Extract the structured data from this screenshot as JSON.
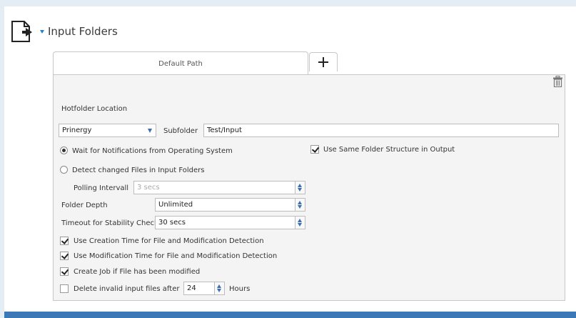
{
  "section": {
    "title": "Input Folders",
    "icon": "folder-output-icon"
  },
  "tabs": [
    {
      "label": "Default Path",
      "active": true
    }
  ],
  "add_tab_icon": "plus-icon",
  "delete_icon": "trash-icon",
  "hotfolder": {
    "label": "Hotfolder Location",
    "location_value": "Prinergy",
    "subfolder_label": "Subfolder",
    "subfolder_value": "Test/Input"
  },
  "options": {
    "wait_notifications": {
      "label": "Wait for Notifications from Operating System",
      "checked": true
    },
    "detect_changed": {
      "label": "Detect changed Files in Input Folders",
      "checked": false
    },
    "same_structure": {
      "label": "Use Same Folder Structure in Output",
      "checked": true
    }
  },
  "polling": {
    "label": "Polling Intervall",
    "value": "3 secs",
    "disabled": true
  },
  "folder_depth": {
    "label": "Folder Depth",
    "value": "Unlimited"
  },
  "timeout": {
    "label": "Timeout for Stability Check",
    "value": "30 secs"
  },
  "checks": {
    "creation_time": {
      "label": "Use Creation Time for File and Modification Detection",
      "checked": true
    },
    "modification_time": {
      "label": "Use Modification Time for File and Modification Detection",
      "checked": true
    },
    "create_job": {
      "label": "Create Job if File has been modified",
      "checked": true
    },
    "delete_invalid": {
      "label": "Delete invalid input files after",
      "checked": false,
      "value": "24",
      "unit": "Hours"
    }
  },
  "colors": {
    "accent": "#3b78b8",
    "panel_bg": "#f4f4f4",
    "page_bg": "#e4ecf4"
  }
}
